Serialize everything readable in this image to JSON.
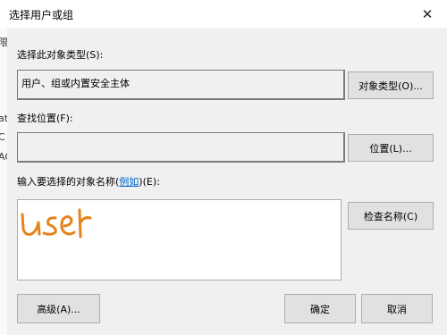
{
  "window": {
    "title": "选择用户或组"
  },
  "left_strip": {
    "chars": [
      "限",
      "at",
      "C",
      "AC"
    ]
  },
  "object_type": {
    "label": "选择此对象类型(S):",
    "value": "用户、组或内置安全主体",
    "button": "对象类型(O)..."
  },
  "location": {
    "label": "查找位置(F):",
    "value": "",
    "button": "位置(L)..."
  },
  "names": {
    "label_pre": "输入要选择的对象名称(",
    "label_link": "例如",
    "label_post": ")(E):",
    "value": "user",
    "check_button": "检查名称(C)"
  },
  "buttons": {
    "advanced": "高级(A)...",
    "ok": "确定",
    "cancel": "取消"
  },
  "colors": {
    "handwriting": "#e8821a",
    "link": "#0066cc"
  }
}
